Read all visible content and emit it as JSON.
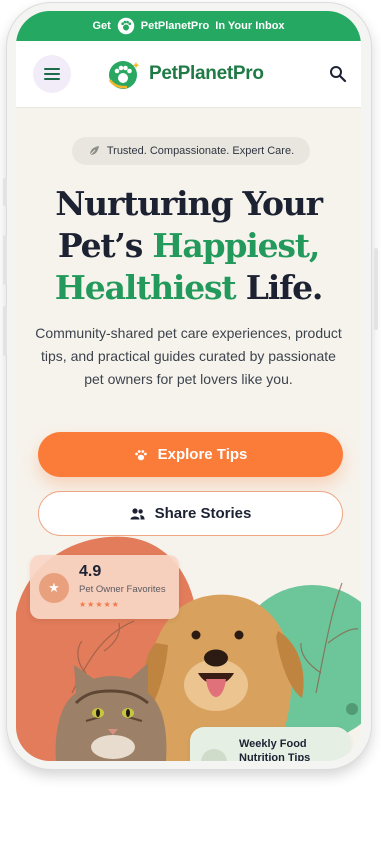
{
  "promo": {
    "prefix": "Get",
    "brand": "PetPlanetPro",
    "suffix": "In Your Inbox"
  },
  "nav": {
    "brand_name": "PetPlanetPro",
    "menu_icon": "hamburger-menu-icon",
    "search_icon": "search-icon"
  },
  "hero": {
    "badge": "Trusted. Compassionate. Expert Care.",
    "headline": {
      "line1": "Nurturing Your",
      "line2_a": "Pet’s ",
      "line2_b": "Happiest,",
      "line3_a": "Healthiest",
      "line3_b": " Life."
    },
    "subtitle": "Community-shared pet care experiences, product tips, and practical guides curated by passionate pet owners for pet lovers like you.",
    "primary_cta": "Explore Tips",
    "secondary_cta": "Share Stories"
  },
  "rating_card": {
    "value": "4.9",
    "label": "Pet Owner Favorites",
    "stars": "★★★★★",
    "rating": 5
  },
  "food_card": {
    "title": "Weekly Food Nutrition Tips"
  },
  "colors": {
    "brand_green": "#25a862",
    "accent_orange": "#fb7c38",
    "headline_dark": "#1d2233"
  }
}
